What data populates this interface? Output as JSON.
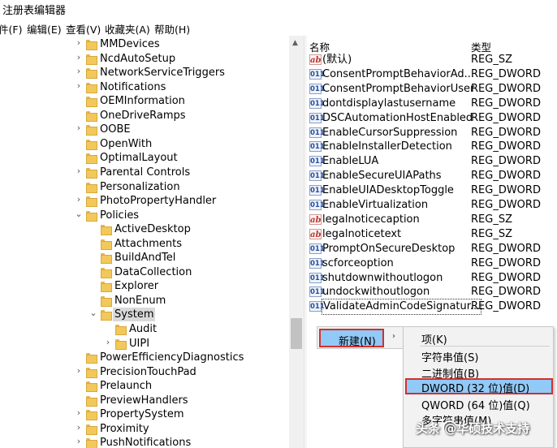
{
  "window": {
    "title": "注册表编辑器"
  },
  "menu": [
    "件(F)",
    "编辑(E)",
    "查看(V)",
    "收藏夹(A)",
    "帮助(H)"
  ],
  "tree": [
    {
      "label": "MMDevices",
      "expander": "›",
      "indent": 1
    },
    {
      "label": "NcdAutoSetup",
      "expander": "›",
      "indent": 1
    },
    {
      "label": "NetworkServiceTriggers",
      "expander": "›",
      "indent": 1
    },
    {
      "label": "Notifications",
      "expander": "›",
      "indent": 1
    },
    {
      "label": "OEMInformation",
      "expander": "",
      "indent": 1
    },
    {
      "label": "OneDriveRamps",
      "expander": "",
      "indent": 1
    },
    {
      "label": "OOBE",
      "expander": "›",
      "indent": 1
    },
    {
      "label": "OpenWith",
      "expander": "",
      "indent": 1
    },
    {
      "label": "OptimalLayout",
      "expander": "",
      "indent": 1
    },
    {
      "label": "Parental Controls",
      "expander": "›",
      "indent": 1
    },
    {
      "label": "Personalization",
      "expander": "",
      "indent": 1
    },
    {
      "label": "PhotoPropertyHandler",
      "expander": "›",
      "indent": 1
    },
    {
      "label": "Policies",
      "expander": "⌄",
      "indent": 1
    },
    {
      "label": "ActiveDesktop",
      "expander": "",
      "indent": 2
    },
    {
      "label": "Attachments",
      "expander": "",
      "indent": 2
    },
    {
      "label": "BuildAndTel",
      "expander": "",
      "indent": 2
    },
    {
      "label": "DataCollection",
      "expander": "",
      "indent": 2
    },
    {
      "label": "Explorer",
      "expander": "",
      "indent": 2
    },
    {
      "label": "NonEnum",
      "expander": "",
      "indent": 2
    },
    {
      "label": "System",
      "expander": "⌄",
      "indent": 2,
      "selected": true
    },
    {
      "label": "Audit",
      "expander": "",
      "indent": 3
    },
    {
      "label": "UIPI",
      "expander": "›",
      "indent": 3
    },
    {
      "label": "PowerEfficiencyDiagnostics",
      "expander": "",
      "indent": 1
    },
    {
      "label": "PrecisionTouchPad",
      "expander": "›",
      "indent": 1
    },
    {
      "label": "Prelaunch",
      "expander": "",
      "indent": 1
    },
    {
      "label": "PreviewHandlers",
      "expander": "",
      "indent": 1
    },
    {
      "label": "PropertySystem",
      "expander": "›",
      "indent": 1
    },
    {
      "label": "Proximity",
      "expander": "›",
      "indent": 1
    },
    {
      "label": "PushNotifications",
      "expander": "›",
      "indent": 1
    }
  ],
  "values_pane": {
    "col_name": "名称",
    "col_type": "类型",
    "rows": [
      {
        "name": "(默认)",
        "type": "REG_SZ",
        "icon": "ab"
      },
      {
        "name": "ConsentPromptBehaviorAd...",
        "type": "REG_DWORD",
        "icon": "dw"
      },
      {
        "name": "ConsentPromptBehaviorUser",
        "type": "REG_DWORD",
        "icon": "dw"
      },
      {
        "name": "dontdisplaylastusername",
        "type": "REG_DWORD",
        "icon": "dw"
      },
      {
        "name": "DSCAutomationHostEnabled",
        "type": "REG_DWORD",
        "icon": "dw"
      },
      {
        "name": "EnableCursorSuppression",
        "type": "REG_DWORD",
        "icon": "dw"
      },
      {
        "name": "EnableInstallerDetection",
        "type": "REG_DWORD",
        "icon": "dw"
      },
      {
        "name": "EnableLUA",
        "type": "REG_DWORD",
        "icon": "dw"
      },
      {
        "name": "EnableSecureUIAPaths",
        "type": "REG_DWORD",
        "icon": "dw"
      },
      {
        "name": "EnableUIADesktopToggle",
        "type": "REG_DWORD",
        "icon": "dw"
      },
      {
        "name": "EnableVirtualization",
        "type": "REG_DWORD",
        "icon": "dw"
      },
      {
        "name": "legalnoticecaption",
        "type": "REG_SZ",
        "icon": "ab"
      },
      {
        "name": "legalnoticetext",
        "type": "REG_SZ",
        "icon": "ab"
      },
      {
        "name": "PromptOnSecureDesktop",
        "type": "REG_DWORD",
        "icon": "dw"
      },
      {
        "name": "scforceoption",
        "type": "REG_DWORD",
        "icon": "dw"
      },
      {
        "name": "shutdownwithoutlogon",
        "type": "REG_DWORD",
        "icon": "dw"
      },
      {
        "name": "undockwithoutlogon",
        "type": "REG_DWORD",
        "icon": "dw"
      },
      {
        "name": "ValidateAdminCodeSignatur...",
        "type": "REG_DWORD",
        "icon": "dw"
      }
    ]
  },
  "context_menu": {
    "new_label": "新建(N)",
    "arrow": "›"
  },
  "submenu": {
    "items": [
      {
        "label": "项(K)"
      },
      {
        "label": "字符串值(S)"
      },
      {
        "label": "二进制值(B)"
      },
      {
        "label": "DWORD (32 位)值(D)",
        "highlight": true
      },
      {
        "label": "QWORD (64 位)值(Q)"
      },
      {
        "label": "多字符串值(M)"
      }
    ]
  },
  "watermark": "头条 @华硕技术支持",
  "colors": {
    "highlight": "#91c9f7",
    "annotation_border": "#d32f2f",
    "folder": "#f3c85a"
  }
}
